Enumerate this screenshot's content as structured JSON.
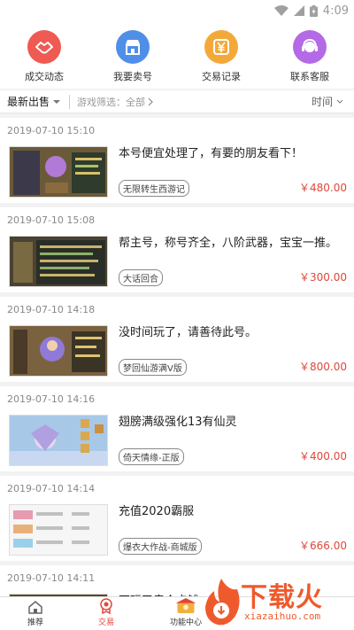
{
  "status_bar": {
    "time": "4:09"
  },
  "quick_actions": [
    {
      "label": "成交动态",
      "icon": "handshake-icon",
      "color": "#ef5a52"
    },
    {
      "label": "我要卖号",
      "icon": "shop-icon",
      "color": "#4f8fe8"
    },
    {
      "label": "交易记录",
      "icon": "yen-icon",
      "color": "#f3a93a"
    },
    {
      "label": "联系客服",
      "icon": "support-agent-icon",
      "color": "#b46ae6"
    }
  ],
  "filter": {
    "latest_label": "最新出售",
    "game_filter": "游戏筛选：全部",
    "time_label": "时间"
  },
  "listings": [
    {
      "date": "2019-07-10 15:10",
      "title": "本号便宜处理了，有要的朋友看下！",
      "game": "无限转生西游记",
      "price": "￥480.00"
    },
    {
      "date": "2019-07-10 15:08",
      "title": "帮主号，称号齐全，八阶武器，宝宝一推。",
      "game": "大话回合",
      "price": "￥300.00"
    },
    {
      "date": "2019-07-10 14:18",
      "title": "没时间玩了，请善待此号。",
      "game": "梦回仙游满V版",
      "price": "￥800.00"
    },
    {
      "date": "2019-07-10 14:16",
      "title": "翅膀满级强化13有仙灵",
      "game": "倚天情缘-正版",
      "price": "￥400.00"
    },
    {
      "date": "2019-07-10 14:14",
      "title": "充值2020霸服",
      "game": "爆衣大作战-商城版",
      "price": "￥666.00"
    },
    {
      "date": "2019-07-10 14:11",
      "title": "不玩了卖个卡钱",
      "game": "",
      "price": ""
    }
  ],
  "tabs": [
    {
      "label": "推荐",
      "icon": "home-icon"
    },
    {
      "label": "交易",
      "icon": "trade-icon"
    },
    {
      "label": "功能中心",
      "icon": "function-center-icon"
    }
  ],
  "watermark": {
    "text": "下载火",
    "sub": "xiazaihuo.com"
  }
}
